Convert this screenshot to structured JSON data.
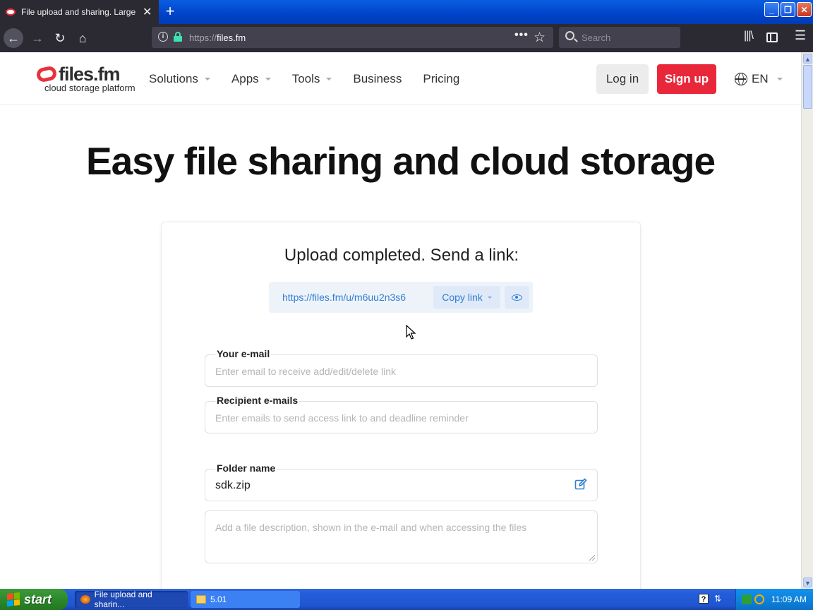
{
  "browser": {
    "tab_title": "File upload and sharing. Large file",
    "url_protocol": "https://",
    "url_domain": "files.fm",
    "search_placeholder": "Search",
    "icons": [
      "back-icon",
      "forward-icon",
      "reload-icon",
      "home-icon",
      "info-icon",
      "lock-icon",
      "more-icon",
      "bookmark-star-icon",
      "search-icon",
      "library-icon",
      "sidebar-icon",
      "menu-icon"
    ]
  },
  "site": {
    "logo_text": "files.fm",
    "logo_tagline": "cloud storage platform",
    "brand_color": "#e8283a",
    "nav": [
      {
        "label": "Solutions"
      },
      {
        "label": "Apps"
      },
      {
        "label": "Tools"
      },
      {
        "label": "Business"
      },
      {
        "label": "Pricing"
      }
    ],
    "login_label": "Log in",
    "signup_label": "Sign up",
    "language": "EN",
    "hero_title": "Easy file sharing and cloud storage"
  },
  "upload": {
    "title": "Upload completed. Send a link:",
    "link": "https://files.fm/u/m6uu2n3s6",
    "copy_label": "Copy link",
    "email_label": "Your e-mail",
    "email_placeholder": "Enter email to receive add/edit/delete link",
    "recipients_label": "Recipient e-mails",
    "recipients_placeholder": "Enter emails to send access link to and deadline reminder",
    "folder_label": "Folder name",
    "folder_value": "sdk.zip",
    "description_placeholder": "Add a file description, shown in the e-mail and when accessing the files",
    "accent_color": "#2f7fd1"
  },
  "taskbar": {
    "start_label": "start",
    "tasks": [
      {
        "label": "File upload and sharin..."
      },
      {
        "label": "5.01"
      }
    ],
    "clock": "11:09 AM"
  }
}
